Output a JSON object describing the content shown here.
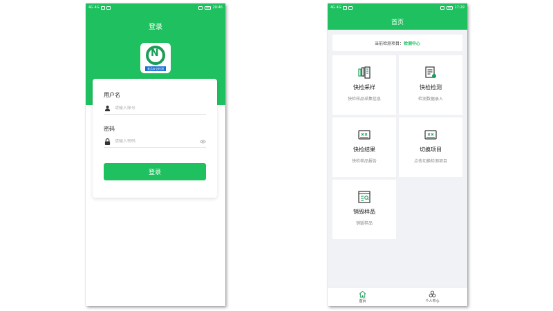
{
  "status_bar": {
    "left_text": "4G 4G",
    "login_time": "20:46",
    "home_time": "17:29"
  },
  "login": {
    "title": "登录",
    "logo_banner": "食品安全检测",
    "username": {
      "label": "用户名",
      "placeholder": "请输入账号",
      "value": ""
    },
    "password": {
      "label": "密码",
      "placeholder": "请输入密码",
      "value": ""
    },
    "submit_label": "登录"
  },
  "home": {
    "title": "首页",
    "project": {
      "prefix": "当前检测项目：",
      "name": "检测中心"
    },
    "tiles": [
      {
        "name": "快检采样",
        "desc": "快检样品采集信息",
        "icon": "sampling-icon"
      },
      {
        "name": "快检检测",
        "desc": "检测数据录入",
        "icon": "detection-icon"
      },
      {
        "name": "快检结果",
        "desc": "快检样品报告",
        "icon": "result-icon"
      },
      {
        "name": "切换项目",
        "desc": "点击切换检测项目",
        "icon": "switch-project-icon"
      },
      {
        "name": "销毁样品",
        "desc": "销毁样品",
        "icon": "destroy-sample-icon"
      }
    ],
    "tabs": [
      {
        "label": "首页",
        "icon": "home-icon"
      },
      {
        "label": "个人中心",
        "icon": "user-center-icon"
      }
    ]
  },
  "colors": {
    "brand_green": "#1fc05f",
    "page_bg": "#f0f2f5",
    "desc_gray": "#8a8a8a"
  }
}
